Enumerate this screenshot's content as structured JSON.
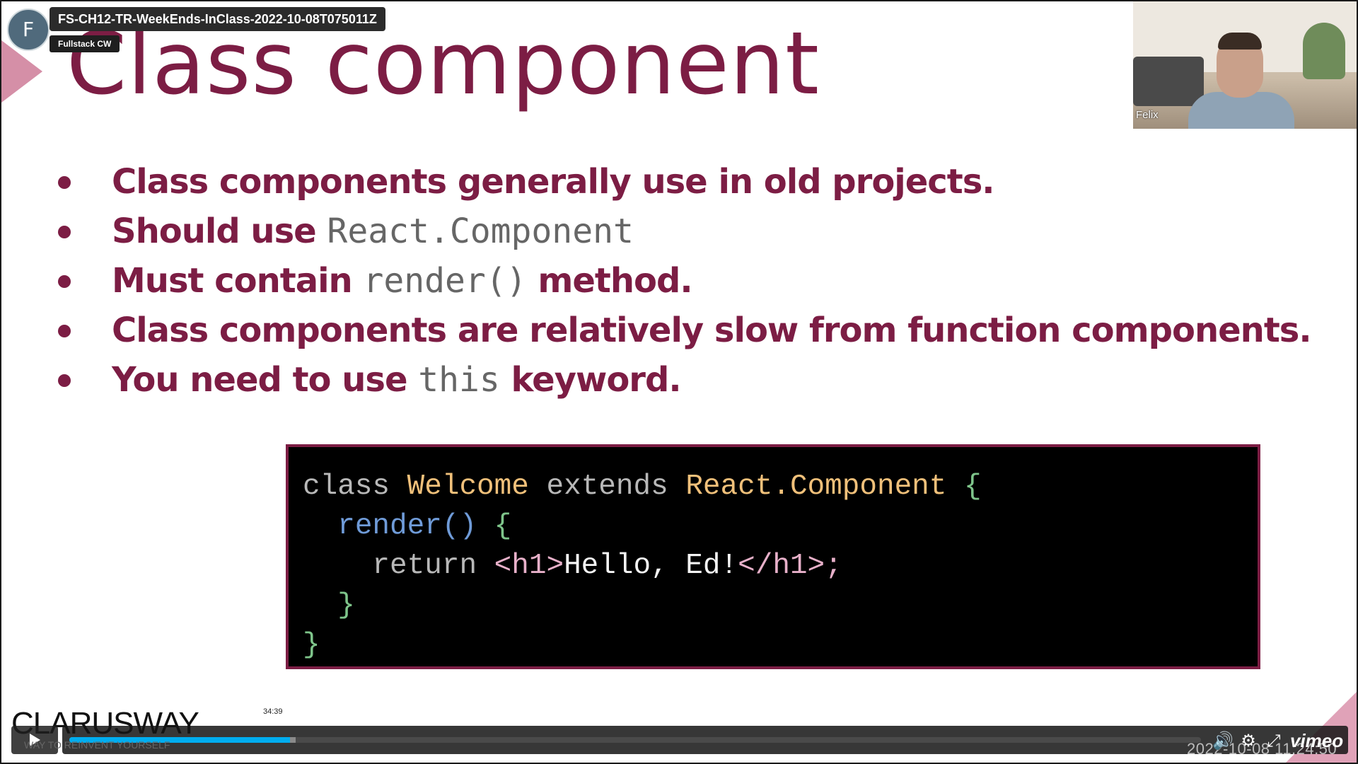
{
  "video": {
    "title": "FS-CH12-TR-WeekEnds-InClass-2022-10-08T075011Z",
    "channel": "Fullstack CW",
    "avatar_letter": "F",
    "participant_name": "Felix",
    "hover_time": "34:39",
    "progress_fraction": 0.195,
    "buffered_fraction": 0.2,
    "logo": "vimeo",
    "timestamp_overlay": "2022-10-08 11:24:50"
  },
  "slide": {
    "title": "Class component",
    "bullets": [
      {
        "text": "Class components  generally use in old projects."
      },
      {
        "before": "Should use ",
        "code": "React.Component",
        "after": ""
      },
      {
        "before": "Must contain ",
        "code": "render()",
        "after": " method."
      },
      {
        "text": "Class components are relatively slow from function components."
      },
      {
        "before": "You need to use ",
        "code": "this",
        "after": " keyword."
      }
    ],
    "code": {
      "line1": {
        "kw1": "class",
        "cls1": "Welcome",
        "kw2": "extends",
        "cls2": "React.Component",
        "brace": "{"
      },
      "line2": {
        "fn": "render()",
        "brace": "{"
      },
      "line3": {
        "kw": "return",
        "tag_open": "<h1>",
        "text": "Hello, Ed!",
        "tag_close": "</h1>;"
      },
      "line4": {
        "brace": "}"
      },
      "line5": {
        "brace": "}"
      }
    }
  },
  "brand": {
    "name": "CLARUSWAY",
    "tagline": "WAY TO REINVENT YOURSELF"
  },
  "colors": {
    "title": "#7c1d44",
    "progress": "#00adef",
    "code_bg": "#000000"
  },
  "icons": {
    "play": "play-icon",
    "volume": "volume-icon",
    "settings": "gear-icon",
    "fullscreen": "collapse-icon"
  }
}
